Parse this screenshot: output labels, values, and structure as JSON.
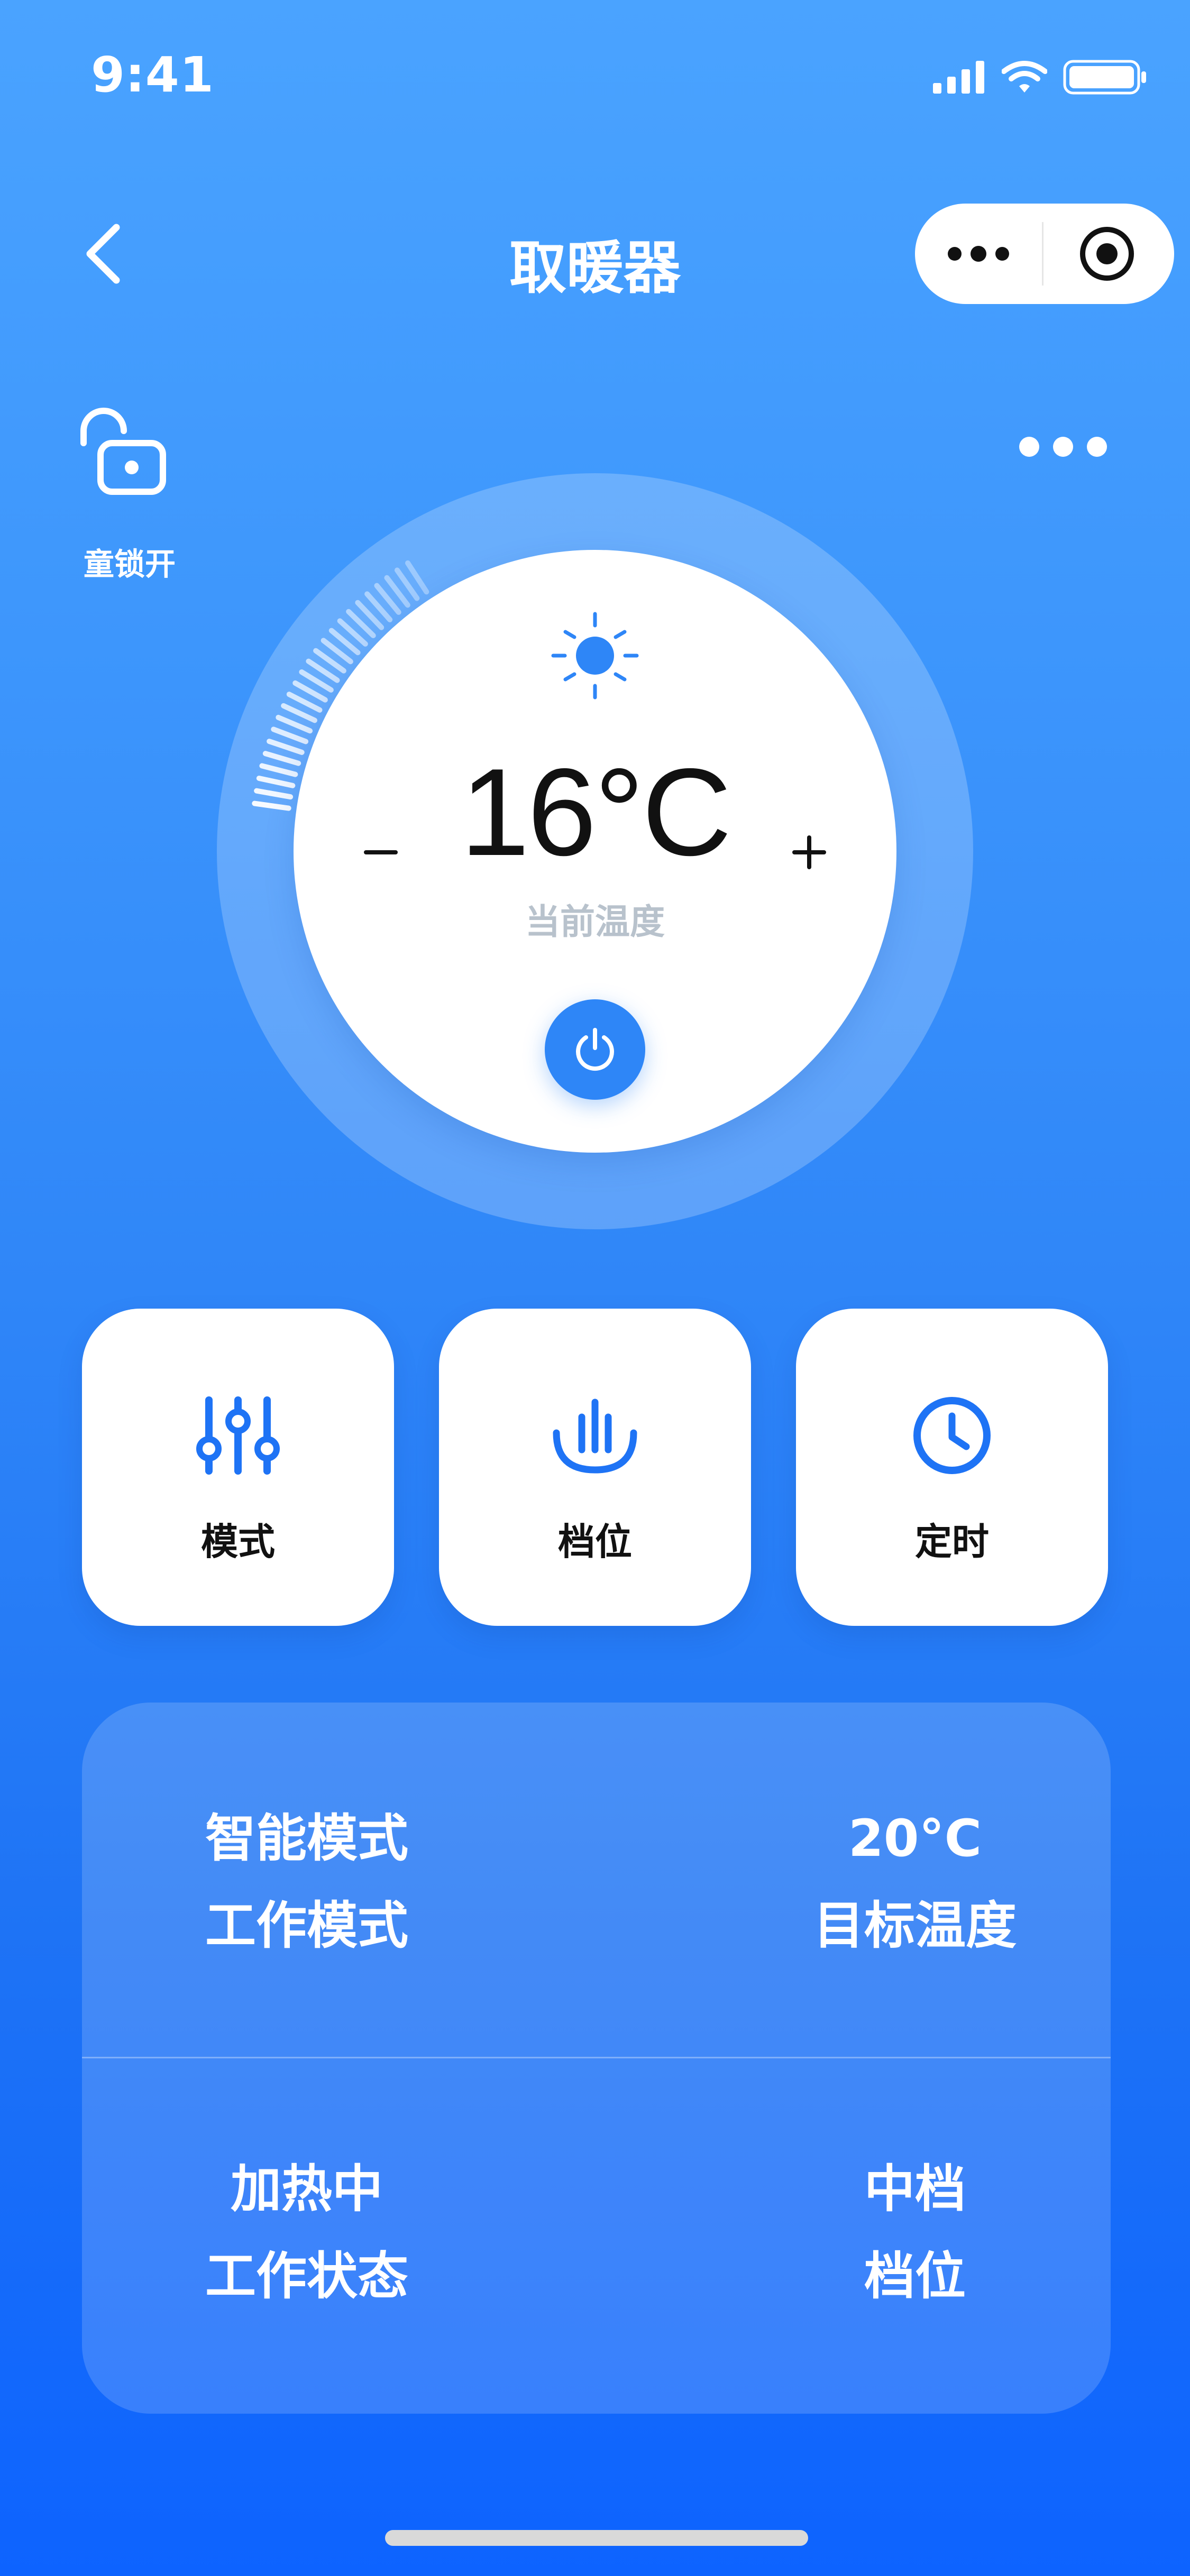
{
  "status_bar": {
    "time": "9:41"
  },
  "nav": {
    "title": "取暖器"
  },
  "child_lock": {
    "label": "童锁开"
  },
  "dial": {
    "temperature": "16°C",
    "temperature_label": "当前温度",
    "minus_label": "-",
    "plus_label": "+"
  },
  "functions": {
    "mode_label": "模式",
    "gear_label": "档位",
    "timer_label": "定时"
  },
  "info": {
    "work_mode_value": "智能模式",
    "work_mode_label": "工作模式",
    "target_temp_value": "20°C",
    "target_temp_label": "目标温度",
    "work_status_value": "加热中",
    "work_status_label": "工作状态",
    "gear_value": "中档",
    "gear_label": "档位"
  },
  "colors": {
    "accent": "#2e86f7",
    "background_top": "#4aa3ff",
    "background_bottom": "#0d63ff"
  },
  "icons": [
    "back-chevron-icon",
    "more-dots-icon",
    "target-icon",
    "unlock-icon",
    "sun-icon",
    "power-icon",
    "sliders-icon",
    "hand-gear-icon",
    "clock-icon"
  ]
}
